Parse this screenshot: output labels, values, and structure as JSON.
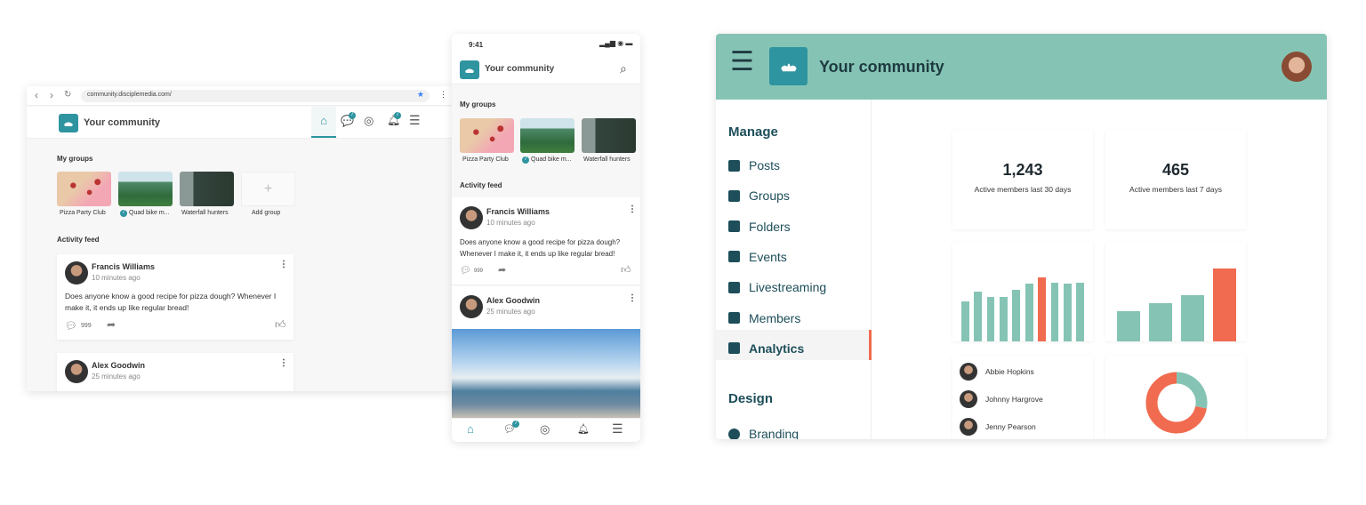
{
  "browser": {
    "url": "community.disciplemedia.com/",
    "title": "Your community",
    "nav_badges": {
      "chat": "7",
      "notifications": "7"
    },
    "my_groups_label": "My groups",
    "groups": [
      {
        "name": "Pizza Party Club"
      },
      {
        "name": "Quad bike m...",
        "badge": "7"
      },
      {
        "name": "Waterfall hunters"
      },
      {
        "name": "Add group"
      }
    ],
    "activity_label": "Activity feed",
    "posts": [
      {
        "author": "Francis Williams",
        "time": "10 minutes ago",
        "text": "Does anyone know a good recipe for pizza dough? Whenever I make it, it ends up like regular bread!",
        "comments": "999"
      },
      {
        "author": "Alex Goodwin",
        "time": "25 minutes ago"
      }
    ]
  },
  "phone": {
    "time": "9:41",
    "title": "Your community",
    "my_groups_label": "My groups",
    "groups": [
      {
        "name": "Pizza Party Club"
      },
      {
        "name": "Quad bike m...",
        "badge": "7"
      },
      {
        "name": "Waterfall hunters"
      }
    ],
    "activity_label": "Activity feed",
    "posts": [
      {
        "author": "Francis Williams",
        "time": "10 minutes ago",
        "text": "Does anyone know a good recipe for pizza dough? Whenever I make it, it ends up like regular bread!",
        "comments": "999"
      },
      {
        "author": "Alex Goodwin",
        "time": "25 minutes ago"
      }
    ],
    "chat_badge": "7"
  },
  "dashboard": {
    "title": "Your community",
    "colors": {
      "header": "#85c4b5",
      "accent": "#f06b4f",
      "teal": "#85c4b5",
      "brand": "#2e94a0"
    },
    "manage_label": "Manage",
    "manage_items": [
      {
        "label": "Posts",
        "icon": "edit-icon"
      },
      {
        "label": "Groups",
        "icon": "groups-icon"
      },
      {
        "label": "Folders",
        "icon": "folder-icon"
      },
      {
        "label": "Events",
        "icon": "calendar-icon"
      },
      {
        "label": "Livestreaming",
        "icon": "play-icon"
      },
      {
        "label": "Members",
        "icon": "members-icon"
      },
      {
        "label": "Analytics",
        "icon": "analytics-icon",
        "active": true
      }
    ],
    "design_label": "Design",
    "design_items": [
      {
        "label": "Branding",
        "icon": "palette-icon"
      }
    ],
    "stats": [
      {
        "value": "1,243",
        "label": "Active members last 30 days"
      },
      {
        "value": "465",
        "label": "Active members last 7 days"
      }
    ],
    "members": [
      "Abbie Hopkins",
      "Johnny Hargrove",
      "Jenny Pearson"
    ]
  },
  "chart_data": [
    {
      "type": "bar",
      "values": [
        62,
        78,
        70,
        70,
        80,
        90,
        100,
        92,
        90,
        92
      ],
      "highlight_index": 6
    },
    {
      "type": "bar",
      "values": [
        42,
        53,
        64,
        100
      ],
      "highlight_index": 3
    },
    {
      "type": "pie",
      "donut": true,
      "values": [
        28,
        72
      ],
      "colors": [
        "#85c4b5",
        "#f06b4f"
      ]
    }
  ]
}
